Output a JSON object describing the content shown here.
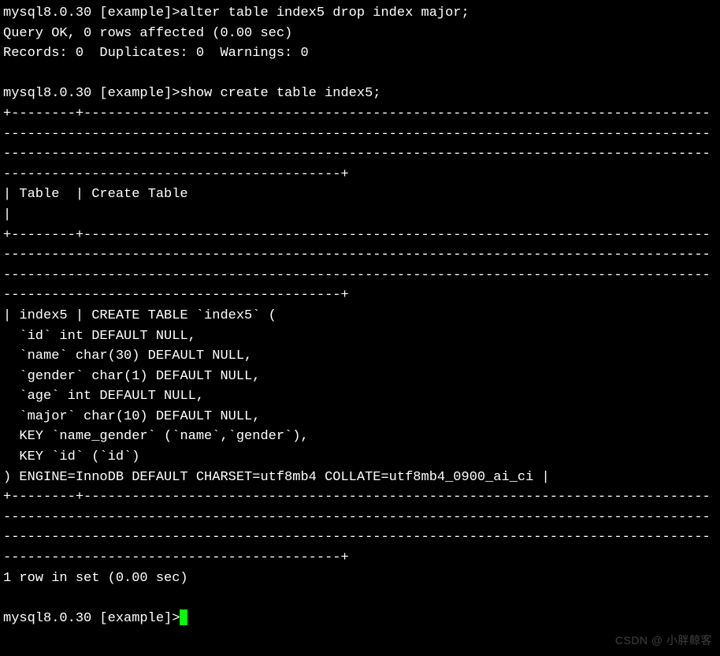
{
  "prompt1": "mysql8.0.30 [example]>",
  "command1": "alter table index5 drop index major;",
  "result1_line1": "Query OK, 0 rows affected (0.00 sec)",
  "result1_line2": "Records: 0  Duplicates: 0  Warnings: 0",
  "prompt2": "mysql8.0.30 [example]>",
  "command2": "show create table index5;",
  "sep1": "+--------+--------------------------------------------------------------------------------------------------------------------------------------------------------------------------------------------------------------------------------------------------------------------------------------------------------+",
  "header_row": "| Table  | Create Table                                                                                                                                                                                                                                                                                           |",
  "sep2": "+--------+--------------------------------------------------------------------------------------------------------------------------------------------------------------------------------------------------------------------------------------------------------------------------------------------------------+",
  "data_row": "| index5 | CREATE TABLE `index5` (\n  `id` int DEFAULT NULL,\n  `name` char(30) DEFAULT NULL,\n  `gender` char(1) DEFAULT NULL,\n  `age` int DEFAULT NULL,\n  `major` char(10) DEFAULT NULL,\n  KEY `name_gender` (`name`,`gender`),\n  KEY `id` (`id`)\n) ENGINE=InnoDB DEFAULT CHARSET=utf8mb4 COLLATE=utf8mb4_0900_ai_ci |",
  "sep3": "+--------+--------------------------------------------------------------------------------------------------------------------------------------------------------------------------------------------------------------------------------------------------------------------------------------------------------+",
  "footer": "1 row in set (0.00 sec)",
  "prompt3": "mysql8.0.30 [example]>",
  "watermark": "CSDN @ 小胖鲸客"
}
